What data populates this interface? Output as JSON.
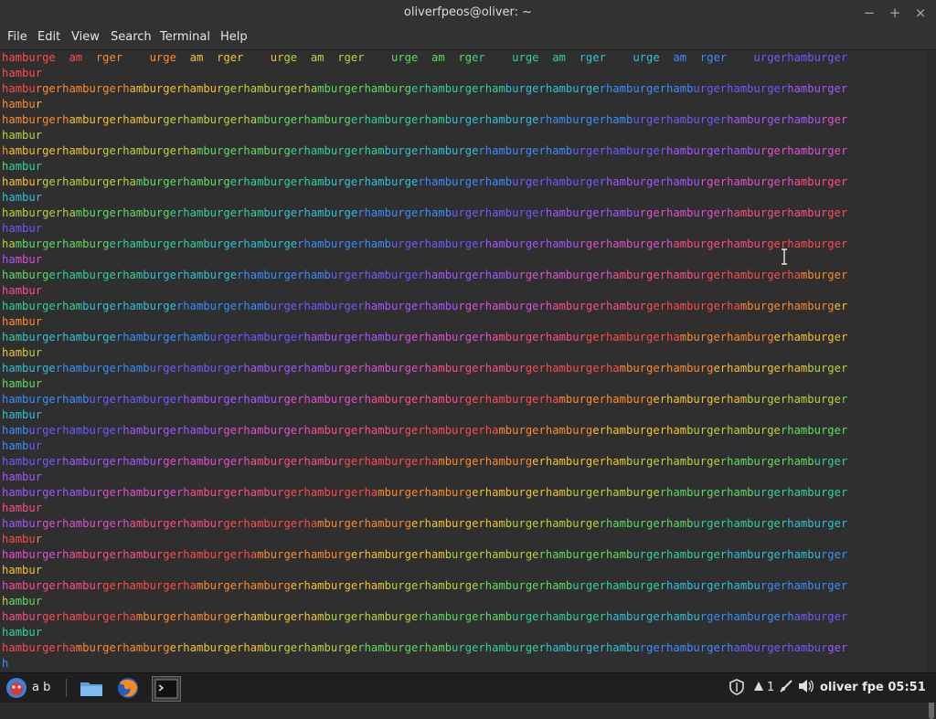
{
  "window": {
    "title": "oliverfpeos@oliver: ~"
  },
  "controls": {
    "minimize": "−",
    "maximize": "+",
    "close": "×"
  },
  "menu": [
    "File",
    "Edit",
    "View",
    "Search",
    "Terminal",
    "Help"
  ],
  "terminal": {
    "first_line": "hamburge  am  rger    urge  am  rger    urge  am  rger    urge  am  rger    urge  am  rger    urge  am  rger    urgerhamburger",
    "full_line": "hamburgerhamburgerhamburgerhamburgerhamburgerhamburgerhamburgerhamburgerhamburgerhamburgerhamburgerhamburgerhamburgerhamburger",
    "wrap_line": "hambur",
    "last_wrap": "h",
    "rows": 20
  },
  "taskbar": {
    "workspace_text": "a b",
    "user_clock": "oliver fpe 05:51",
    "update_count": "1"
  },
  "colors": {
    "rainbow": [
      "#ff4b4b",
      "#ff8a2a",
      "#f2c230",
      "#b8d43a",
      "#5fdc5f",
      "#2fd39a",
      "#2fc0d8",
      "#3a8cff",
      "#6a5cff",
      "#a455ff",
      "#e04fd0",
      "#ff4b8a"
    ]
  }
}
